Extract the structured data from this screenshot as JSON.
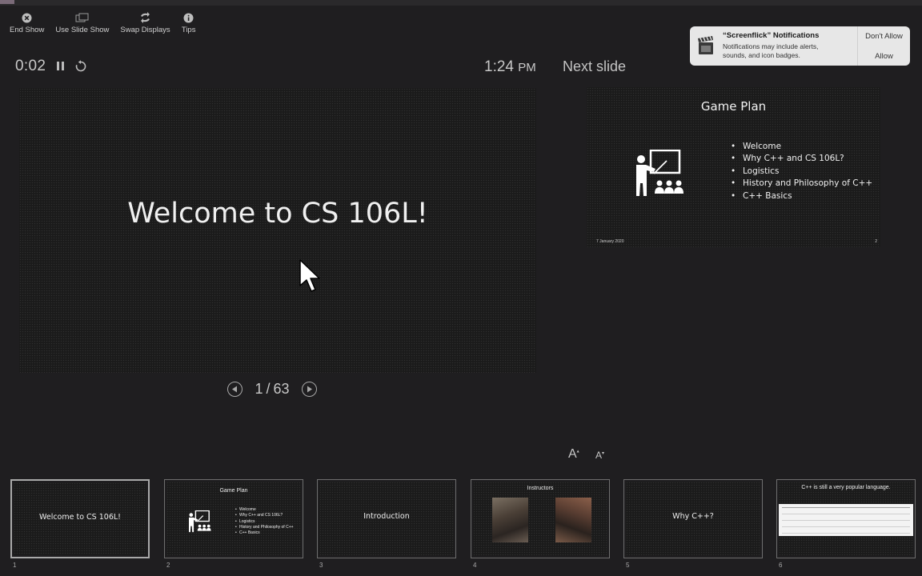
{
  "toolbar": {
    "items": [
      {
        "label": "End Show",
        "icon": "close-circle-icon"
      },
      {
        "label": "Use Slide Show",
        "icon": "window-icon"
      },
      {
        "label": "Swap Displays",
        "icon": "swap-icon"
      },
      {
        "label": "Tips",
        "icon": "info-icon"
      }
    ]
  },
  "timer": {
    "elapsed": "0:02",
    "pause_icon": "pause-icon",
    "reset_icon": "reset-icon"
  },
  "clock": {
    "time": "1:24",
    "ampm": "PM"
  },
  "next_slide_label": "Next slide",
  "current_slide": {
    "title": "Welcome to CS 106L!"
  },
  "navigation": {
    "current": "1",
    "separator": "/",
    "total": "63"
  },
  "next_slide": {
    "title": "Game Plan",
    "bullets": [
      "Welcome",
      "Why C++ and CS 106L?",
      "Logistics",
      "History and Philosophy of C++",
      "C++ Basics"
    ],
    "date": "7 January 2020",
    "number": "2"
  },
  "notification": {
    "title": "“Screenflick” Notifications",
    "body": "Notifications may include alerts, sounds, and icon badges.",
    "dont_allow": "Don't Allow",
    "allow": "Allow"
  },
  "font_controls": {
    "increase": "A",
    "decrease": "A"
  },
  "thumbnails": [
    {
      "number": "1",
      "title": "Welcome to CS 106L!"
    },
    {
      "number": "2",
      "title": "Game Plan",
      "bullets": [
        "Welcome",
        "Why C++ and CS 106L?",
        "Logistics",
        "History and Philosophy of C++",
        "C++ Basics"
      ]
    },
    {
      "number": "3",
      "title": "Introduction"
    },
    {
      "number": "4",
      "title": "Instructors"
    },
    {
      "number": "5",
      "title": "Why C++?"
    },
    {
      "number": "6",
      "title": "C++ is still a very popular language."
    }
  ],
  "colors": {
    "background": "#1f1e20",
    "notification_bg": "#e7e7e7"
  }
}
